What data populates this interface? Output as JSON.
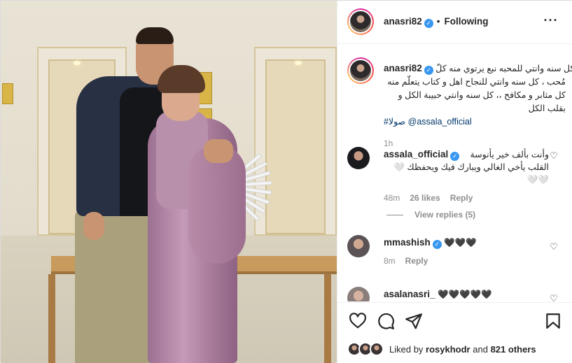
{
  "post": {
    "author": "anasri82",
    "follow_status": "Following",
    "caption_first_line": "كل سنه وانتي للمحبه نبع يرتوي منه كلّ",
    "caption_rest": "مُحب ، كل سنه وانتي للنجاح اهل و كتاب يتعلّم منه كل مثابر و مكافح ،، كل سنه وانتي حبيبة الكل و بقلب الكل",
    "caption_mention": "@assala_official",
    "caption_hashtag": "#صولا",
    "time_ago": "1h"
  },
  "comments": [
    {
      "username": "assala_official",
      "verified": true,
      "text_line1": "وأنت بألف خير يأنوسة",
      "text_line2": "القلب يأخي الغالي ويبارك فيك ويحفظك 🤍🤍🤍",
      "time": "48m",
      "likes": "26 likes",
      "reply": "Reply",
      "view_replies": "View replies (5)"
    },
    {
      "username": "mmashish",
      "verified": true,
      "text": "🖤🖤🖤",
      "time": "8m",
      "reply": "Reply"
    },
    {
      "username": "asalanasri_",
      "verified": false,
      "text": "🖤🖤🖤🖤🖤"
    }
  ],
  "likes": {
    "prefix": "Liked by",
    "user": "rosykhodr",
    "middle": "and",
    "count": "821 others"
  },
  "icons": {
    "more": "more-options-icon",
    "like": "heart-icon",
    "comment": "comment-icon",
    "share": "share-icon",
    "save": "bookmark-icon",
    "verified": "verified-badge-icon",
    "comment_like": "small-heart-icon"
  },
  "colors": {
    "verified": "#3897f0",
    "link": "#00376b",
    "muted": "#8e8e8e",
    "text": "#262626"
  }
}
